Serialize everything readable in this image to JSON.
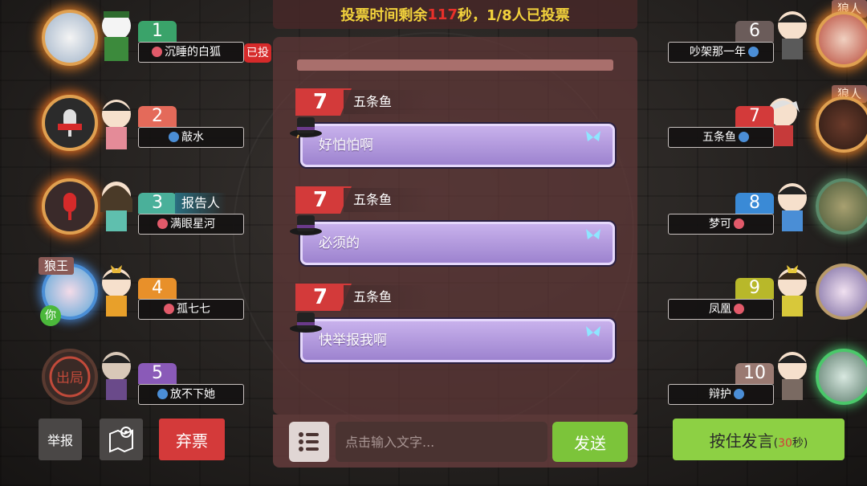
{
  "banner": {
    "prefix": "投票时间剩余",
    "seconds": "117",
    "suffix": "秒，1/8人已投票"
  },
  "chat": {
    "messages": [
      {
        "num": "7",
        "name": "五条鱼",
        "text": "好怕怕啊"
      },
      {
        "num": "7",
        "name": "五条鱼",
        "text": "必须的"
      },
      {
        "num": "7",
        "name": "五条鱼",
        "text": "快举报我啊"
      }
    ],
    "input_placeholder": "点击输入文字...",
    "send_label": "发送"
  },
  "players_left": [
    {
      "num": "1",
      "name": "沉睡的白狐",
      "gender": "female",
      "tag": "已投",
      "num_color": "#3aa36a"
    },
    {
      "num": "2",
      "name": "敲水",
      "gender": "male",
      "num_color": "#e46a5a"
    },
    {
      "num": "3",
      "name": "满眼星河",
      "gender": "female",
      "role": "报告人",
      "num_color": "#4ab09a"
    },
    {
      "num": "4",
      "name": "孤七七",
      "gender": "female",
      "badge": "狼王",
      "you": "你",
      "num_color": "#e8902a"
    },
    {
      "num": "5",
      "name": "放不下她",
      "gender": "male",
      "avatar_text": "出局",
      "num_color": "#8a5ab8"
    }
  ],
  "players_right": [
    {
      "num": "6",
      "name": "吵架那一年",
      "gender": "male",
      "badge": "狼人",
      "num_color": "#6b5c5a"
    },
    {
      "num": "7",
      "name": "五条鱼",
      "gender": "male",
      "badge": "狼人",
      "num_color": "#d33a3a"
    },
    {
      "num": "8",
      "name": "梦可",
      "gender": "female",
      "num_color": "#3a8ad6"
    },
    {
      "num": "9",
      "name": "凤凰",
      "gender": "female",
      "num_color": "#b8b82a"
    },
    {
      "num": "10",
      "name": "辩护",
      "gender": "male",
      "num_color": "#9a7a72"
    }
  ],
  "buttons": {
    "report": "举报",
    "abstain": "弃票",
    "hold_to_speak": "按住发言",
    "hold_seconds": "30",
    "hold_unit": "秒"
  },
  "colors": {
    "banner_text": "#f2d23c",
    "timer_red": "#e8302a",
    "send_green": "#7cc43a",
    "abstain_red": "#d43a3a",
    "bubble_purple": "#b29ae0"
  }
}
